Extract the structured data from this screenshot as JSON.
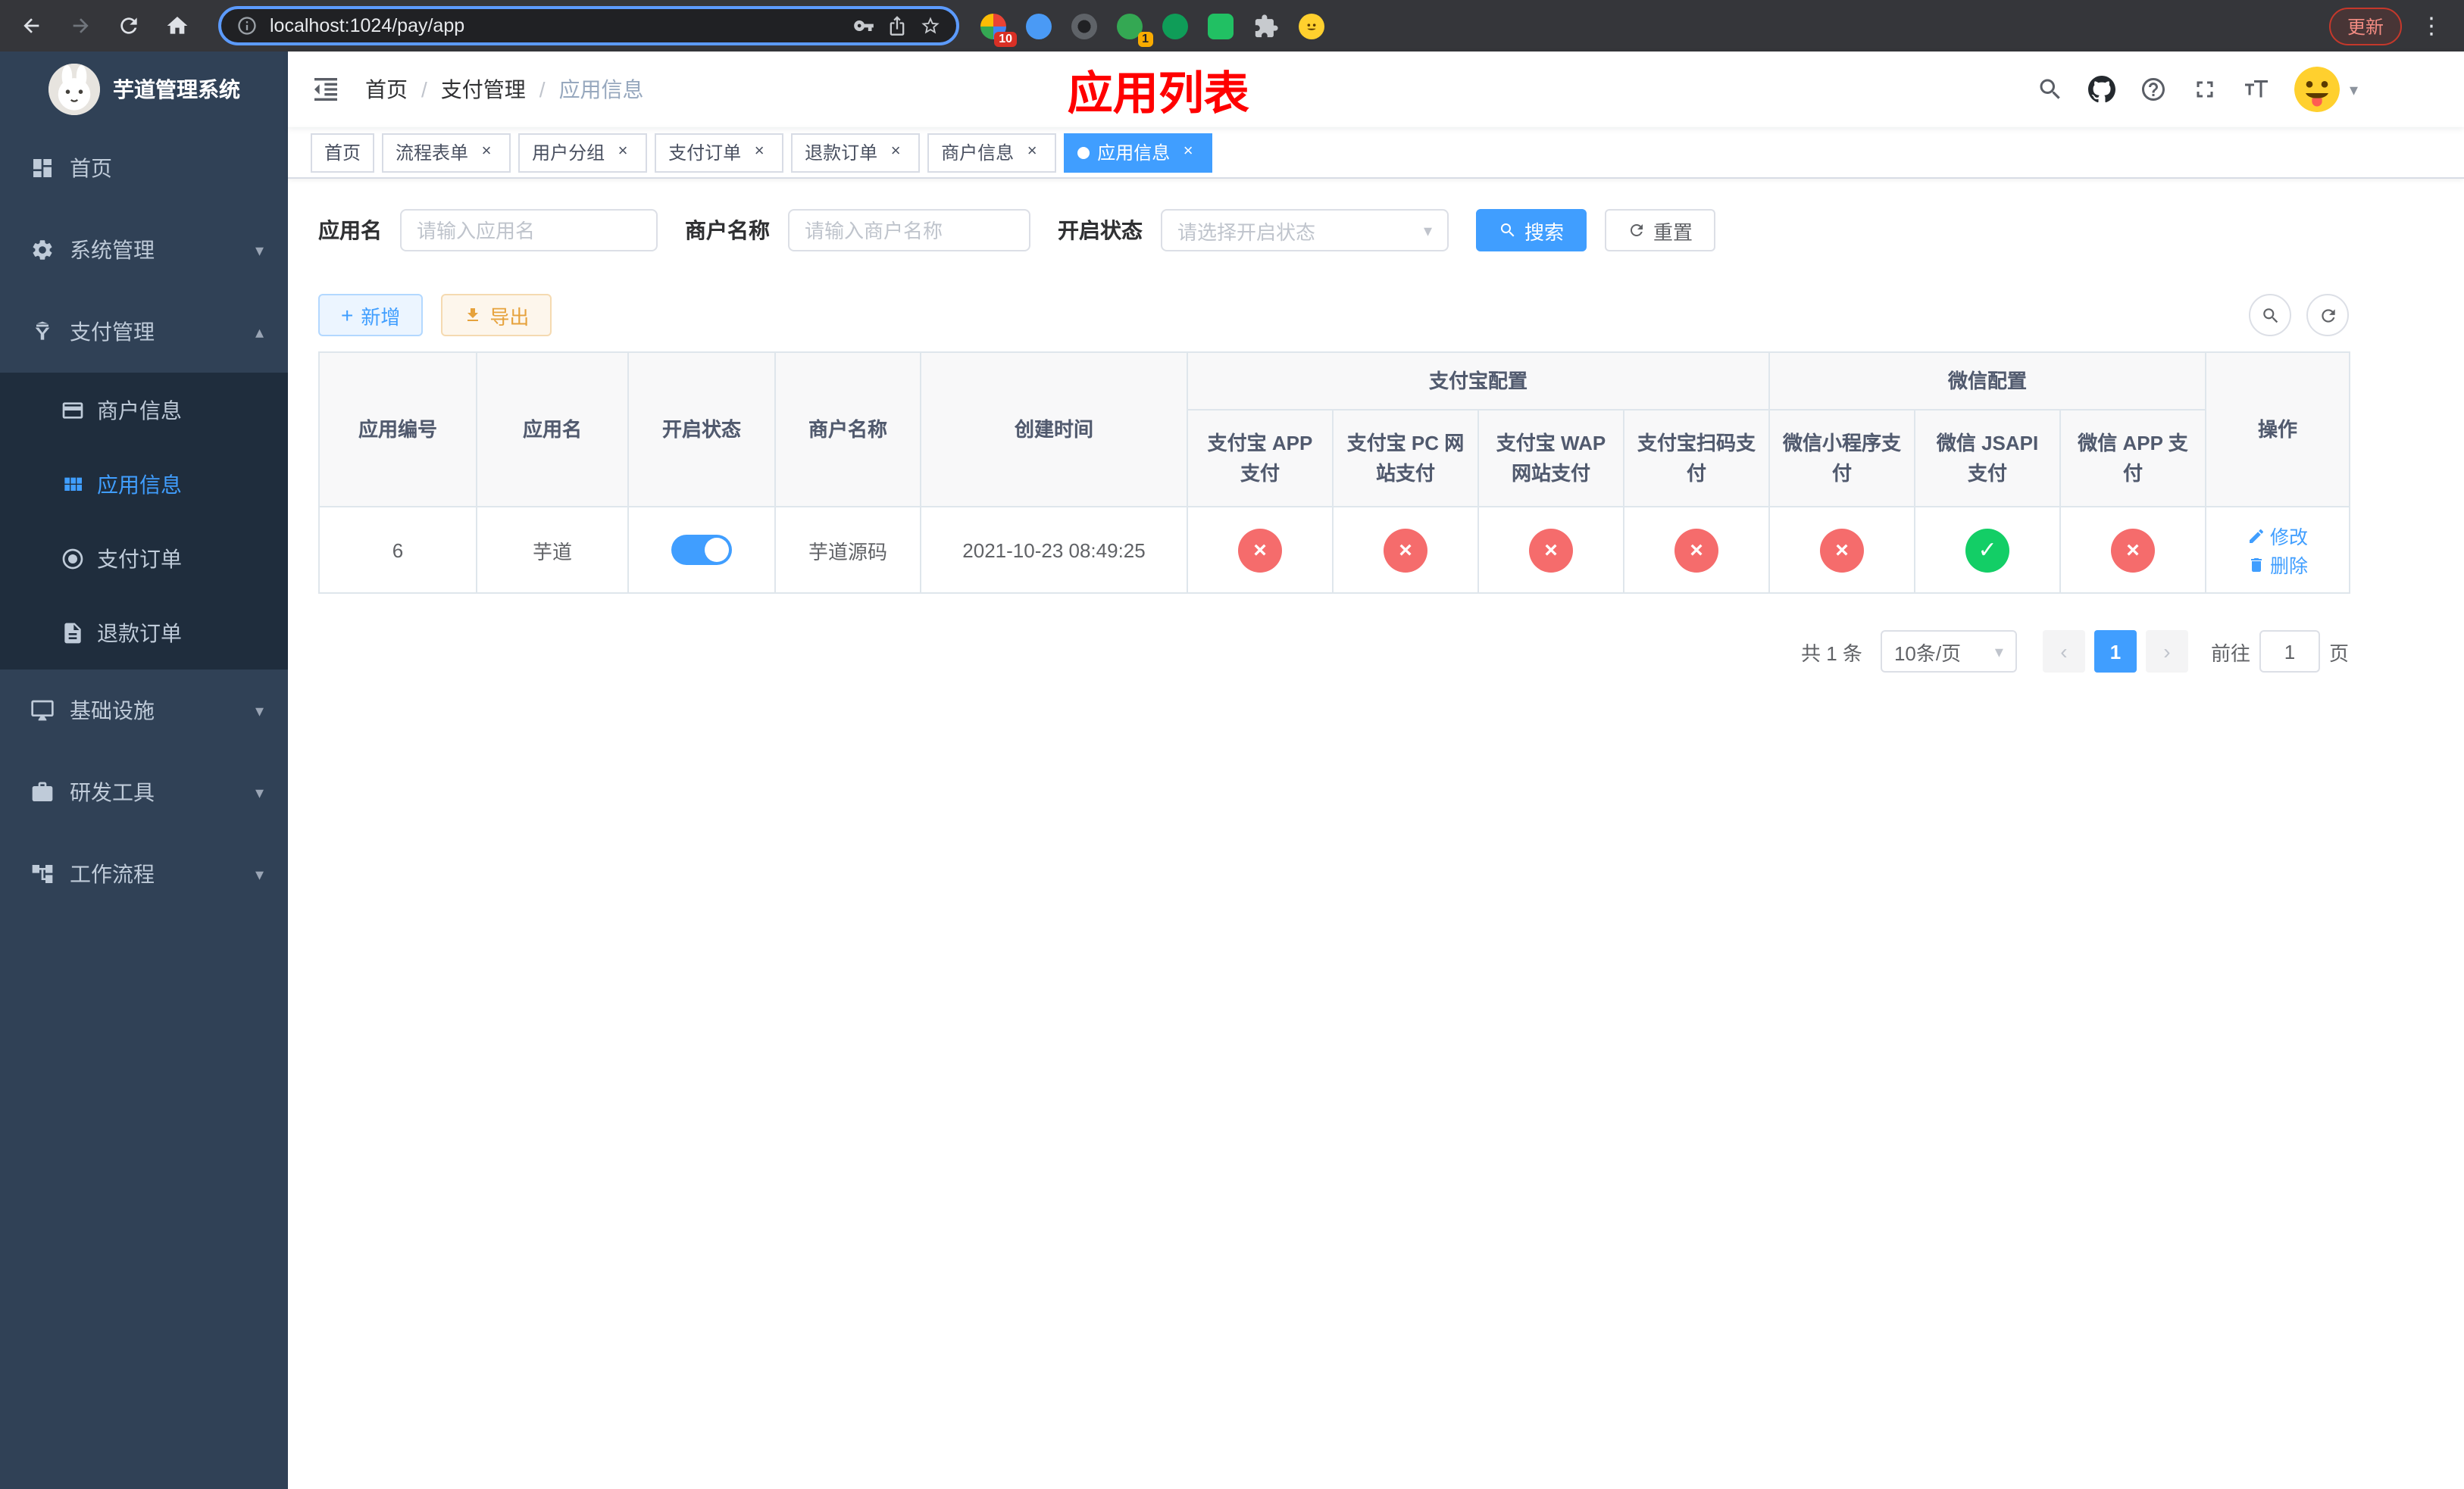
{
  "browser": {
    "url": "localhost:1024/pay/app",
    "update_label": "更新",
    "extension_badge_1": "10",
    "extension_badge_2": "1"
  },
  "icons": {
    "close": "×",
    "caret_down": "▾",
    "caret_up": "▴",
    "check": "✓",
    "cross": "×",
    "plus": "+",
    "prev": "‹",
    "next": "›",
    "menu_dots": "⋮"
  },
  "sidebar": {
    "title": "芋道管理系统",
    "menu": {
      "home": "首页",
      "system": "系统管理",
      "payment": "支付管理",
      "merchant_info": "商户信息",
      "app_info": "应用信息",
      "pay_order": "支付订单",
      "refund_order": "退款订单",
      "infrastructure": "基础设施",
      "dev_tools": "研发工具",
      "workflow": "工作流程"
    }
  },
  "header": {
    "breadcrumb": {
      "home": "首页",
      "section": "支付管理",
      "current": "应用信息",
      "separator": "/"
    },
    "title": "应用列表"
  },
  "tabs": [
    {
      "label": "首页"
    },
    {
      "label": "流程表单"
    },
    {
      "label": "用户分组"
    },
    {
      "label": "支付订单"
    },
    {
      "label": "退款订单"
    },
    {
      "label": "商户信息"
    },
    {
      "label": "应用信息"
    }
  ],
  "filters": {
    "app_name_label": "应用名",
    "app_name_placeholder": "请输入应用名",
    "merchant_label": "商户名称",
    "merchant_placeholder": "请输入商户名称",
    "status_label": "开启状态",
    "status_placeholder": "请选择开启状态",
    "search_button": "搜索",
    "reset_button": "重置"
  },
  "toolbar": {
    "add_button": "新增",
    "export_button": "导出"
  },
  "table": {
    "groups": {
      "alipay": "支付宝配置",
      "wechat": "微信配置"
    },
    "columns": [
      "应用编号",
      "应用名",
      "开启状态",
      "商户名称",
      "创建时间",
      "支付宝 APP 支付",
      "支付宝 PC 网站支付",
      "支付宝 WAP 网站支付",
      "支付宝扫码支付",
      "微信小程序支付",
      "微信 JSAPI 支付",
      "微信 APP 支付",
      "操作"
    ],
    "rows": [
      {
        "app_no": "6",
        "app_name": "芋道",
        "status_on": true,
        "merchant_name": "芋道源码",
        "create_time": "2021-10-23 08:49:25",
        "flags": {
          "alipay_app": false,
          "alipay_pc": false,
          "alipay_wap": false,
          "alipay_qr": false,
          "wechat_mini": false,
          "wechat_jsapi": true,
          "wechat_app": false
        },
        "edit_label": "修改",
        "delete_label": "删除"
      }
    ]
  },
  "pagination": {
    "total_text": "共 1 条",
    "page_size": "10条/页",
    "current_page": "1",
    "goto_label": "前往",
    "goto_value": "1",
    "page_unit": "页"
  },
  "colors": {
    "accent": "#409eff",
    "danger": "#f56c6c",
    "success": "#13ce66",
    "title_red": "#ff0000",
    "sidebar_bg": "#304156",
    "submenu_bg": "#1f2d3d"
  }
}
